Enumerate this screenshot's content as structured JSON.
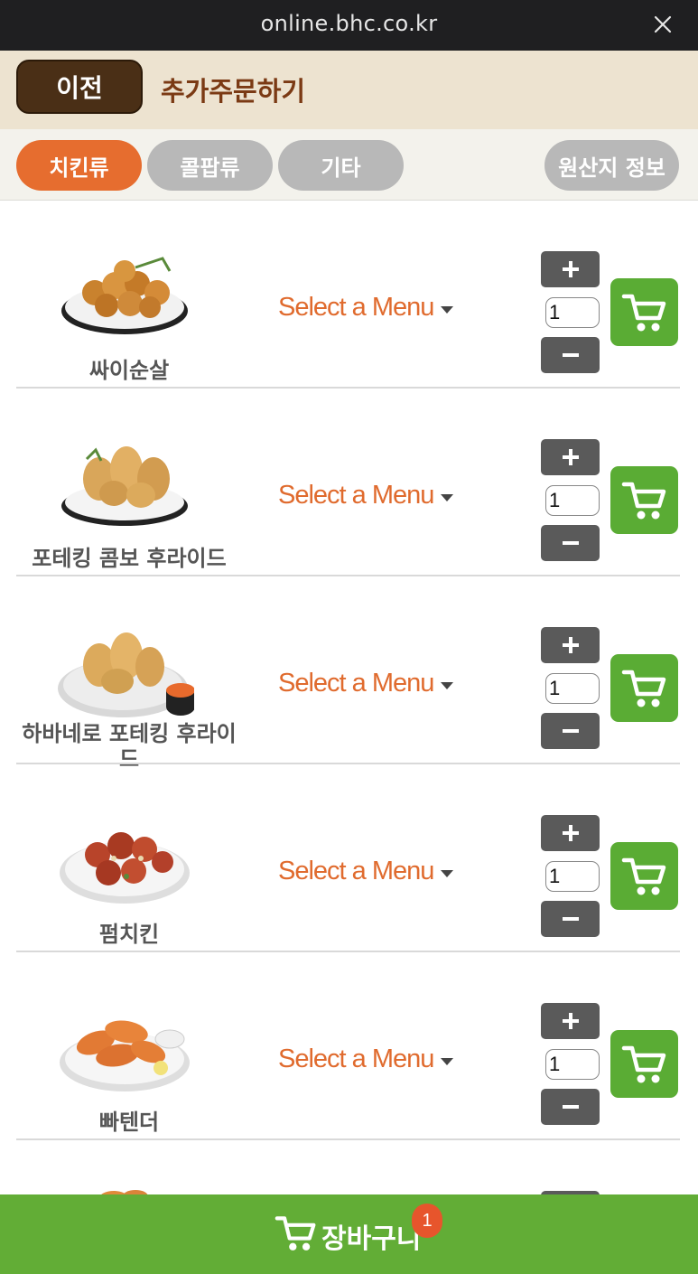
{
  "browser": {
    "url": "online.bhc.co.kr",
    "close_icon": "close-icon"
  },
  "header": {
    "prev_label": "이전",
    "title": "추가주문하기"
  },
  "tabs": [
    {
      "label": "치킨류",
      "active": true
    },
    {
      "label": "콜팝류",
      "active": false
    },
    {
      "label": "기타",
      "active": false
    },
    {
      "label": "원산지 정보",
      "active": false
    }
  ],
  "menu": {
    "select_label": "Select a Menu",
    "items": [
      {
        "name": "싸이순살",
        "qty": "1"
      },
      {
        "name": "포테킹 콤보 후라이드",
        "qty": "1"
      },
      {
        "name": "하바네로 포테킹 후라이드",
        "qty": "1"
      },
      {
        "name": "펌치킨",
        "qty": "1"
      },
      {
        "name": "빠텐더",
        "qty": "1"
      }
    ]
  },
  "cart": {
    "label": "장바구니",
    "count": "1"
  },
  "colors": {
    "accent": "#e66d2f",
    "cart_green": "#62ad36",
    "brown": "#4a2f16"
  }
}
